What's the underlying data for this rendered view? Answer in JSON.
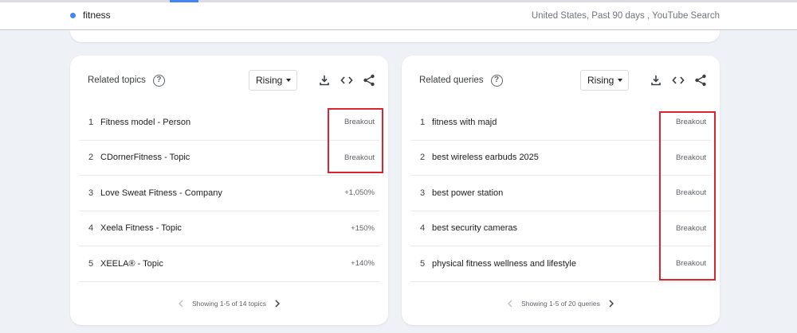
{
  "header": {
    "term": "fitness",
    "filters": "United States, Past 90 days , YouTube Search",
    "accent_color": "#4285f4"
  },
  "panels": [
    {
      "title": "Related topics",
      "help_icon": "help-circle-icon",
      "sort_label": "Rising",
      "rows": [
        {
          "index": "1",
          "name": "Fitness model - Person",
          "value": "Breakout"
        },
        {
          "index": "2",
          "name": "CDornerFitness - Topic",
          "value": "Breakout"
        },
        {
          "index": "3",
          "name": "Love Sweat Fitness - Company",
          "value": "+1,050%"
        },
        {
          "index": "4",
          "name": "Xeela Fitness - Topic",
          "value": "+150%"
        },
        {
          "index": "5",
          "name": "XEELA® - Topic",
          "value": "+140%"
        }
      ],
      "pager": "Showing 1-5 of 14 topics"
    },
    {
      "title": "Related queries",
      "help_icon": "help-circle-icon",
      "sort_label": "Rising",
      "rows": [
        {
          "index": "1",
          "name": "fitness with majd",
          "value": "Breakout"
        },
        {
          "index": "2",
          "name": "best wireless earbuds 2025",
          "value": "Breakout"
        },
        {
          "index": "3",
          "name": "best power station",
          "value": "Breakout"
        },
        {
          "index": "4",
          "name": "best security cameras",
          "value": "Breakout"
        },
        {
          "index": "5",
          "name": "physical fitness wellness and lifestyle",
          "value": "Breakout"
        }
      ],
      "pager": "Showing 1-5 of 20 queries"
    }
  ],
  "highlight_color": "#d9262e"
}
